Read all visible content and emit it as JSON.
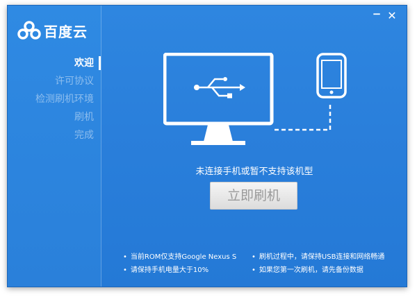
{
  "app": {
    "name": "百度云"
  },
  "window_controls": {
    "minimize": "−",
    "close": "✕"
  },
  "steps": [
    {
      "label": "欢迎",
      "active": true
    },
    {
      "label": "许可协议",
      "active": false
    },
    {
      "label": "检测刷机环境",
      "active": false
    },
    {
      "label": "刷机",
      "active": false
    },
    {
      "label": "完成",
      "active": false
    }
  ],
  "main": {
    "status": "未连接手机或暂不支持该机型",
    "flash_button": "立即刷机",
    "icons": [
      "monitor-icon",
      "usb-icon",
      "phone-icon"
    ]
  },
  "tips": [
    "当前ROM仅支持Google Nexus S",
    "刷机过程中，请保持USB连接和网络畅通",
    "请保持手机电量大于10%",
    "如果您第一次刷机，请先备份数据"
  ],
  "colors": {
    "background": "#2a7fdb",
    "text": "#ffffff",
    "inactive_step": "#7fb6ec",
    "button_text": "#9a9a9a"
  }
}
